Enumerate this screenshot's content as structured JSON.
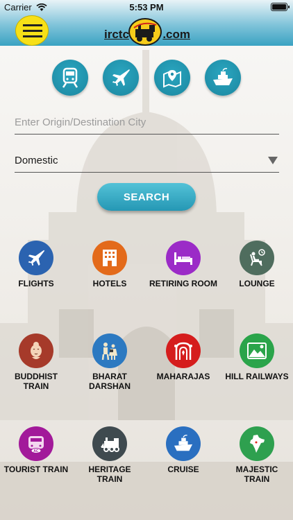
{
  "status_bar": {
    "carrier": "Carrier",
    "time": "5:53 PM"
  },
  "header": {
    "logo_left": "irctc",
    "logo_right": ".com",
    "menu_icon": "hamburger-menu-icon"
  },
  "modes": [
    {
      "name": "train",
      "icon": "train-icon"
    },
    {
      "name": "flight",
      "icon": "airplane-icon"
    },
    {
      "name": "map",
      "icon": "map-pin-icon"
    },
    {
      "name": "cruise",
      "icon": "ship-icon"
    }
  ],
  "search": {
    "origin_placeholder": "Enter Origin/Destination City",
    "origin_value": "",
    "scope_value": "Domestic",
    "button_label": "SEARCH"
  },
  "tiles": [
    {
      "label": "FLIGHTS",
      "icon": "airplane-icon",
      "color": "#2b63b0"
    },
    {
      "label": "HOTELS",
      "icon": "hotel-building-icon",
      "color": "#e36a1a"
    },
    {
      "label": "RETIRING ROOM",
      "icon": "bed-icon",
      "color": "#9b2bc7"
    },
    {
      "label": "LOUNGE",
      "icon": "lounge-chair-icon",
      "color": "#4f6d5e"
    },
    {
      "label": "BUDDHIST TRAIN",
      "icon": "buddha-icon",
      "color": "#a63a2a"
    },
    {
      "label": "BHARAT DARSHAN",
      "icon": "family-icon",
      "color": "#2c79c1"
    },
    {
      "label": "MAHARAJAS",
      "icon": "palace-arch-icon",
      "color": "#d51d1d"
    },
    {
      "label": "HILL RAILWAYS",
      "icon": "mountain-icon",
      "color": "#2aa44a"
    },
    {
      "label": "TOURIST TRAIN",
      "icon": "ac-train-icon",
      "color": "#a21a9a"
    },
    {
      "label": "HERITAGE TRAIN",
      "icon": "steam-engine-icon",
      "color": "#3f4a4f"
    },
    {
      "label": "CRUISE",
      "icon": "ship-icon",
      "color": "#2a6fc0"
    },
    {
      "label": "MAJESTIC TRAIN",
      "icon": "india-map-icon",
      "color": "#2ea04f"
    }
  ],
  "tile_label_lines": {
    "buddhist": [
      "BUDDHIST",
      "TRAIN"
    ],
    "bharat": [
      "BHARAT",
      "DARSHAN"
    ]
  }
}
